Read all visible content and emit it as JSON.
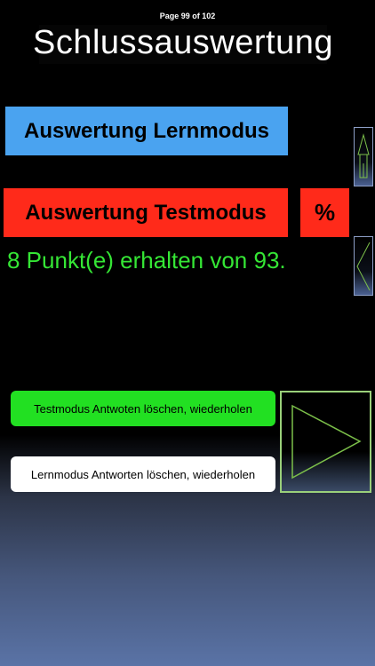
{
  "header": {
    "page_indicator": "Page 99 of 102",
    "title": "Schlussauswertung"
  },
  "buttons": {
    "learn_mode": "Auswertung Lernmodus",
    "test_mode": "Auswertung Testmodus",
    "percent": "%",
    "reset_test": "Testmodus Antwoten löschen, wiederholen",
    "reset_learn": "Lernmodus Antworten löschen, wiederholen"
  },
  "result": {
    "score_text": "8 Punkt(e) erhalten von 93."
  },
  "icons": {
    "up": "up-arrow-icon",
    "back": "back-arrow-icon",
    "play": "play-icon"
  },
  "colors": {
    "learn_button": "#4aa3f0",
    "test_button": "#ff2a1a",
    "score_text": "#35e635",
    "reset_test_button": "#22e022",
    "reset_learn_button": "#ffffff"
  }
}
